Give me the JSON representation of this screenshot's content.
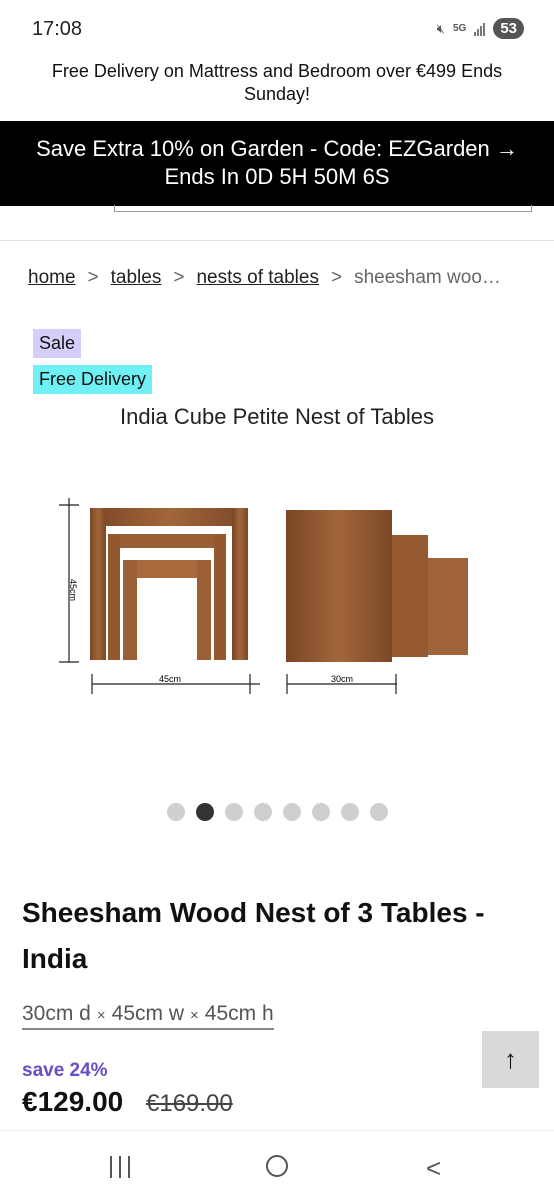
{
  "status_bar": {
    "time": "17:08",
    "network": "5G",
    "battery": "53"
  },
  "promo": {
    "text": "Free Delivery on Mattress and Bedroom over €499 Ends Sunday!"
  },
  "banner": {
    "line1": "Save Extra 10% on Garden - Code: EZGarden →",
    "line2": "Ends In 0D 5H 50M 6S"
  },
  "breadcrumb": {
    "items": [
      "home",
      "tables",
      "nests of tables"
    ],
    "separator": ">",
    "current": "sheesham woo…"
  },
  "badges": {
    "sale": "Sale",
    "free_delivery": "Free Delivery"
  },
  "image": {
    "title": "India Cube Petite Nest of Tables",
    "dim_height": "45cm",
    "dim_width": "45cm",
    "dim_depth": "30cm"
  },
  "carousel": {
    "count": 8,
    "active_index": 1
  },
  "product": {
    "title": "Sheesham Wood Nest of 3 Tables - India",
    "dimensions": {
      "depth": "30cm d",
      "width": "45cm w",
      "height": "45cm h",
      "separator": "×"
    },
    "save": "save 24%",
    "price": "€129.00",
    "was_price": "€169.00"
  },
  "scroll_top": {
    "icon": "↑"
  },
  "nav": {
    "back": "<"
  },
  "colors": {
    "banner_bg": "#000000",
    "sale_badge": "#d6cdfa",
    "free_badge": "#6ff0f5",
    "save_text": "#6a4cc8",
    "wood": "#8a5530"
  }
}
